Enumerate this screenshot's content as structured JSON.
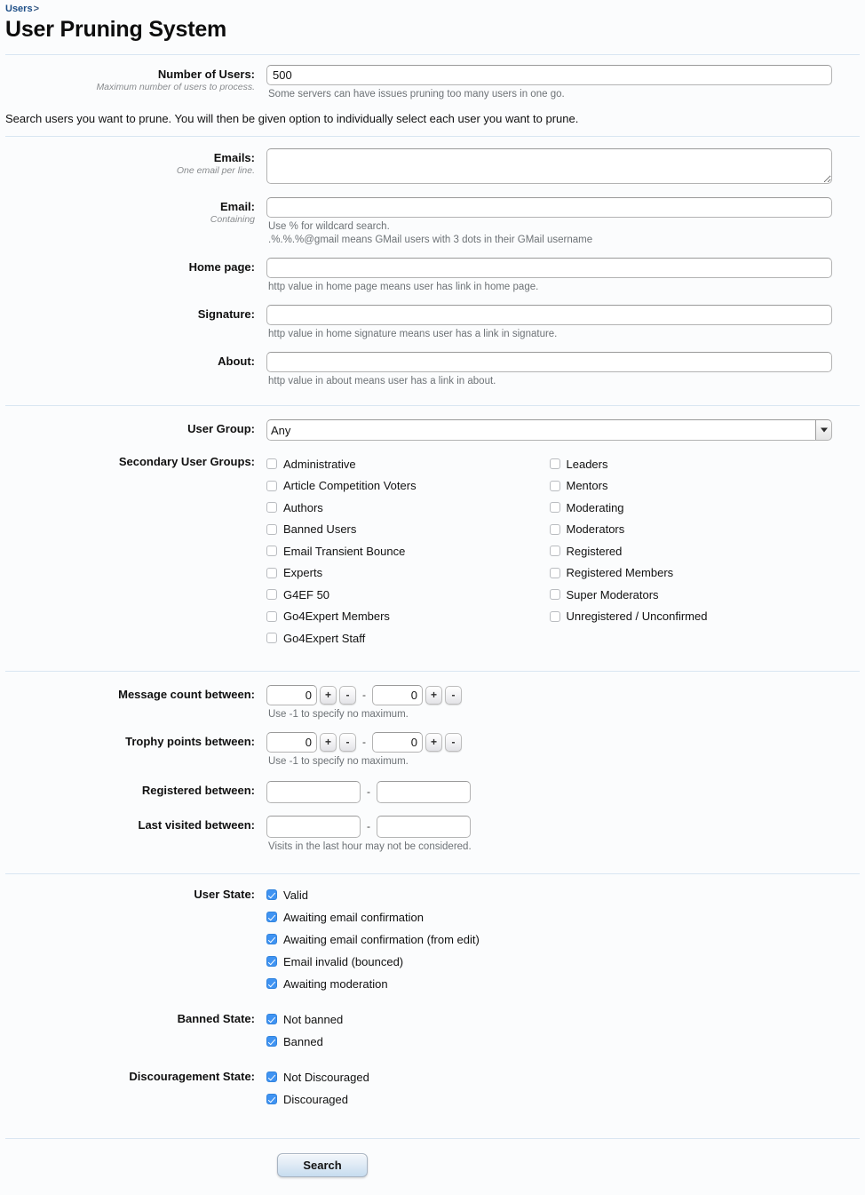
{
  "breadcrumb": {
    "parent": "Users",
    "separator": ">"
  },
  "page": {
    "title": "User Pruning System"
  },
  "intro": "Search users you want to prune. You will then be given option to individually select each user you want to prune.",
  "fields": {
    "number_of_users": {
      "label": "Number of Users:",
      "sublabel": "Maximum number of users to process.",
      "value": "500",
      "explain": "Some servers can have issues pruning too many users in one go."
    },
    "emails": {
      "label": "Emails:",
      "sublabel": "One email per line.",
      "value": ""
    },
    "email": {
      "label": "Email:",
      "sublabel": "Containing",
      "value": "",
      "explain1": "Use % for wildcard search.",
      "explain2": ".%.%.%@gmail means GMail users with 3 dots in their GMail username"
    },
    "home_page": {
      "label": "Home page:",
      "value": "",
      "explain": "http value in home page means user has link in home page."
    },
    "signature": {
      "label": "Signature:",
      "value": "",
      "explain": "http value in home signature means user has a link in signature."
    },
    "about": {
      "label": "About:",
      "value": "",
      "explain": "http value in about means user has a link in about."
    },
    "user_group": {
      "label": "User Group:",
      "selected": "Any",
      "options": [
        "Any"
      ]
    },
    "secondary_user_groups": {
      "label": "Secondary User Groups:",
      "left": [
        {
          "label": "Administrative",
          "checked": false
        },
        {
          "label": "Article Competition Voters",
          "checked": false
        },
        {
          "label": "Authors",
          "checked": false
        },
        {
          "label": "Banned Users",
          "checked": false
        },
        {
          "label": "Email Transient Bounce",
          "checked": false
        },
        {
          "label": "Experts",
          "checked": false
        },
        {
          "label": "G4EF 50",
          "checked": false
        },
        {
          "label": "Go4Expert Members",
          "checked": false
        },
        {
          "label": "Go4Expert Staff",
          "checked": false
        }
      ],
      "right": [
        {
          "label": "Leaders",
          "checked": false
        },
        {
          "label": "Mentors",
          "checked": false
        },
        {
          "label": "Moderating",
          "checked": false
        },
        {
          "label": "Moderators",
          "checked": false
        },
        {
          "label": "Registered",
          "checked": false
        },
        {
          "label": "Registered Members",
          "checked": false
        },
        {
          "label": "Super Moderators",
          "checked": false
        },
        {
          "label": "Unregistered / Unconfirmed",
          "checked": false
        }
      ]
    },
    "message_count": {
      "label": "Message count between:",
      "min": "0",
      "max": "0",
      "plus": "+",
      "minus": "-",
      "dash": "-",
      "explain": "Use -1 to specify no maximum."
    },
    "trophy_points": {
      "label": "Trophy points between:",
      "min": "0",
      "max": "0",
      "plus": "+",
      "minus": "-",
      "dash": "-",
      "explain": "Use -1 to specify no maximum."
    },
    "registered_between": {
      "label": "Registered between:",
      "from": "",
      "to": "",
      "dash": "-"
    },
    "last_visited_between": {
      "label": "Last visited between:",
      "from": "",
      "to": "",
      "dash": "-",
      "explain": "Visits in the last hour may not be considered."
    },
    "user_state": {
      "label": "User State:",
      "items": [
        {
          "label": "Valid",
          "checked": true
        },
        {
          "label": "Awaiting email confirmation",
          "checked": true
        },
        {
          "label": "Awaiting email confirmation (from edit)",
          "checked": true
        },
        {
          "label": "Email invalid (bounced)",
          "checked": true
        },
        {
          "label": "Awaiting moderation",
          "checked": true
        }
      ]
    },
    "banned_state": {
      "label": "Banned State:",
      "items": [
        {
          "label": "Not banned",
          "checked": true
        },
        {
          "label": "Banned",
          "checked": true
        }
      ]
    },
    "discouragement_state": {
      "label": "Discouragement State:",
      "items": [
        {
          "label": "Not Discouraged",
          "checked": true
        },
        {
          "label": "Discouraged",
          "checked": true
        }
      ]
    }
  },
  "actions": {
    "search": "Search"
  },
  "colors": {
    "link": "#1d4e87",
    "checkbox_checked": "#3f93f2",
    "divider": "#d9e6f2",
    "background": "#fbfcfd"
  }
}
